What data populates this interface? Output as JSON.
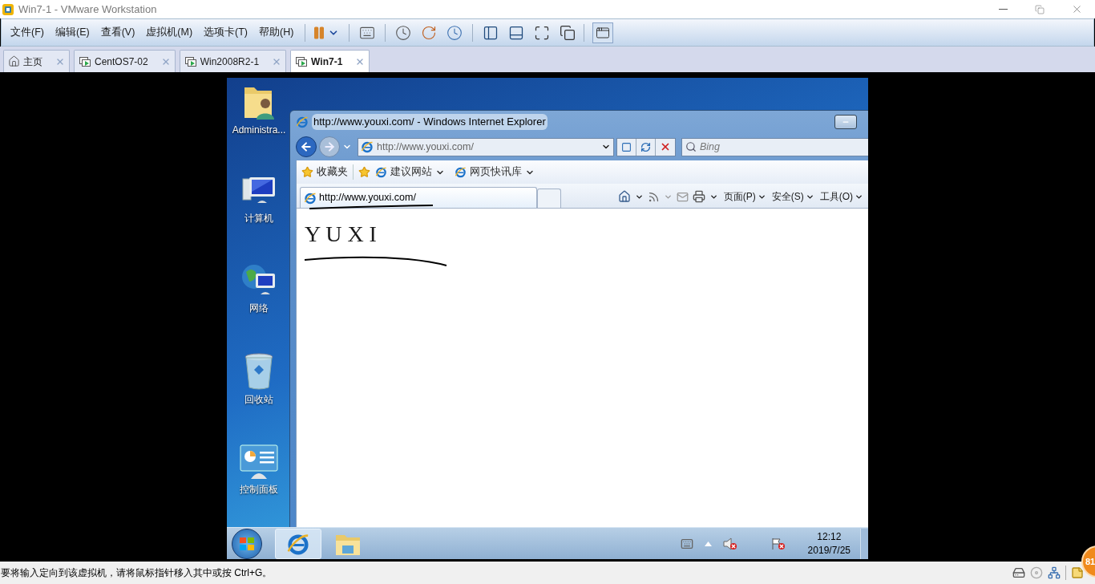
{
  "window": {
    "title": "Win7-1 - VMware Workstation"
  },
  "menu": [
    "文件(F)",
    "编辑(E)",
    "查看(V)",
    "虚拟机(M)",
    "选项卡(T)",
    "帮助(H)"
  ],
  "tabs": [
    {
      "label": "主页",
      "kind": "home",
      "selected": false
    },
    {
      "label": "CentOS7-02",
      "kind": "vm",
      "selected": false
    },
    {
      "label": "Win2008R2-1",
      "kind": "vm",
      "selected": false
    },
    {
      "label": "Win7-1",
      "kind": "vm",
      "selected": true
    }
  ],
  "desktop_icons": [
    {
      "label": "Administra...",
      "kind": "user"
    },
    {
      "label": "计算机",
      "kind": "computer"
    },
    {
      "label": "网络",
      "kind": "network"
    },
    {
      "label": "回收站",
      "kind": "bin"
    },
    {
      "label": "控制面板",
      "kind": "panel"
    }
  ],
  "browser": {
    "title": "http://www.youxi.com/ - Windows Internet Explorer",
    "address": "http://www.youxi.com/",
    "search": {
      "placeholder": "Bing"
    },
    "favorites": "收藏夹",
    "favorite_links": [
      "建议网站",
      "网页快讯库"
    ],
    "tab_title": "http://www.youxi.com/",
    "commands": [
      "页面(P)",
      "安全(S)",
      "工具(O)"
    ],
    "heading": "Y U X I"
  },
  "taskbar": {
    "apps": [
      {
        "kind": "ie",
        "selected": true
      },
      {
        "kind": "folder",
        "selected": false
      }
    ],
    "time": "12:12",
    "date": "2019/7/25"
  },
  "status_bar": {
    "message": "要将输入定向到该虚拟机，请将鼠标指针移入其中或按 Ctrl+G。",
    "badge": "81"
  }
}
